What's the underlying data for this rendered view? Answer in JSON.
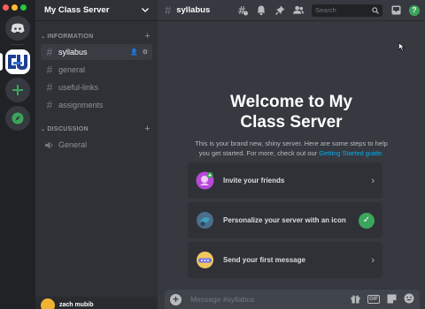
{
  "window": {
    "traffic_colors": [
      "#ff5f57",
      "#febc2e",
      "#28c840"
    ]
  },
  "server": {
    "name": "My Class Server"
  },
  "categories": [
    {
      "label": "INFORMATION",
      "channels": [
        {
          "name": "syllabus",
          "type": "text",
          "active": true
        },
        {
          "name": "general",
          "type": "text"
        },
        {
          "name": "useful-links",
          "type": "text"
        },
        {
          "name": "assignments",
          "type": "text"
        }
      ]
    },
    {
      "label": "DISCUSSION",
      "channels": [
        {
          "name": "General",
          "type": "voice"
        }
      ]
    }
  ],
  "user": {
    "name": "zach mubib"
  },
  "channel": {
    "title": "syllabus"
  },
  "search": {
    "placeholder": "Search"
  },
  "welcome": {
    "title": "Welcome to My Class Server",
    "description": "This is your brand new, shiny server. Here are some steps to help you get started. For more, check out our",
    "link": "Getting Started guide."
  },
  "cards": [
    {
      "label": "Invite your friends",
      "icon": "invite-icon"
    },
    {
      "label": "Personalize your server with an icon",
      "icon": "personalize-icon",
      "done": true
    },
    {
      "label": "Send your first message",
      "icon": "message-icon"
    }
  ],
  "composer": {
    "placeholder": "Message #syllabus"
  },
  "colors": {
    "accent": "#3ba55c",
    "link": "#00aff4",
    "brand": "#5865f2"
  }
}
